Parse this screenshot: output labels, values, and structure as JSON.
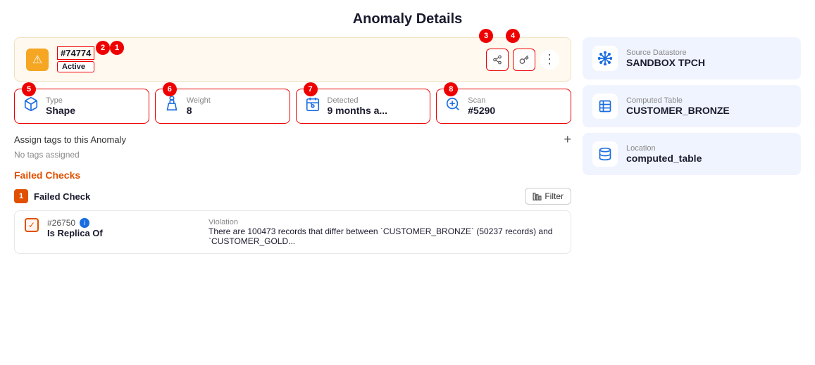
{
  "page": {
    "title": "Anomaly Details"
  },
  "anomaly": {
    "id": "#74774",
    "status": "Active",
    "badge1_num": "1",
    "badge2_num": "2",
    "badge3_num": "3",
    "badge4_num": "4"
  },
  "actions": {
    "share_label": "share",
    "key_label": "key",
    "more_label": "more"
  },
  "info_cards": [
    {
      "badge_num": "5",
      "label": "Type",
      "value": "Shape",
      "icon": "cube"
    },
    {
      "badge_num": "6",
      "label": "Weight",
      "value": "8",
      "icon": "weight"
    },
    {
      "badge_num": "7",
      "label": "Detected",
      "value": "9 months a...",
      "icon": "calendar"
    },
    {
      "badge_num": "8",
      "label": "Scan",
      "value": "#5290",
      "icon": "scan"
    }
  ],
  "tags": {
    "label": "Assign tags to this Anomaly",
    "empty_text": "No tags assigned",
    "plus": "+"
  },
  "failed_checks": {
    "section_title": "Failed Checks",
    "badge": "1",
    "label": "Failed Check",
    "filter_label": "Filter",
    "check": {
      "id": "#26750",
      "name": "Is Replica Of",
      "violation_label": "Violation",
      "violation_text": "There are 100473 records that differ between `CUSTOMER_BRONZE` (50237 records) and `CUSTOMER_GOLD..."
    }
  },
  "right_panel": {
    "cards": [
      {
        "label": "Source Datastore",
        "value": "SANDBOX TPCH",
        "icon": "snowflake"
      },
      {
        "label": "Computed Table",
        "value": "CUSTOMER_BRONZE",
        "icon": "table"
      },
      {
        "label": "Location",
        "value": "computed_table",
        "icon": "database"
      }
    ]
  }
}
